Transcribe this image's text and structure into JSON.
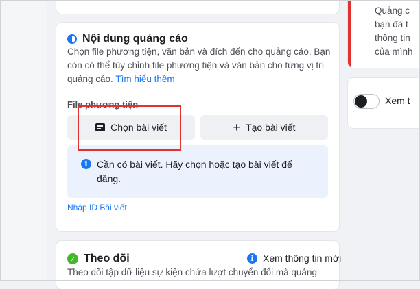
{
  "ad_content": {
    "title": "Nội dung quảng cáo",
    "description": "Chọn file phương tiện, văn bản và đích đến cho quảng cáo. Bạn còn có thể tùy chỉnh file phương tiện và văn bản cho từng vị trí quảng cáo.",
    "learn_more": "Tìm hiểu thêm",
    "media_label": "File phương tiện",
    "choose_post_label": "Chọn bài viết",
    "create_post_label": "Tạo bài viết",
    "info_message": "Cần có bài viết. Hãy chọn hoặc tạo bài viết để đăng.",
    "import_id_label": "Nhập ID Bài viết"
  },
  "tracking": {
    "title": "Theo dõi",
    "view_info": "Xem thông tin mới",
    "description": "Theo dõi tập dữ liệu sự kiện chứa lượt chuyển đổi mà quảng"
  },
  "right_panel": {
    "lines": [
      "Quảng c",
      "bạn đã t",
      "thông tin",
      "của mình"
    ],
    "toggle_label": "Xem t"
  },
  "colors": {
    "accent": "#1877f2",
    "highlight": "#e0322f",
    "success": "#42b72a"
  }
}
